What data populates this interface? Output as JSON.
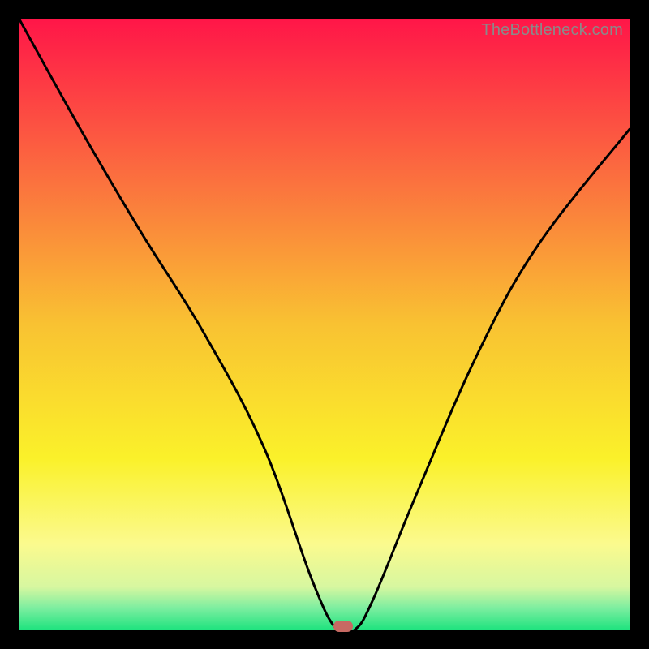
{
  "watermark": "TheBottleneck.com",
  "chart_data": {
    "type": "line",
    "title": "",
    "xlabel": "",
    "ylabel": "",
    "xlim": [
      0,
      100
    ],
    "ylim": [
      0,
      100
    ],
    "grid": false,
    "series": [
      {
        "name": "bottleneck-curve",
        "x": [
          0,
          10,
          20,
          30,
          40,
          48,
          52,
          55,
          58,
          65,
          75,
          85,
          100
        ],
        "y": [
          100,
          82,
          65,
          49,
          30,
          8,
          0,
          0,
          5,
          22,
          45,
          63,
          82
        ],
        "color": "#000000"
      }
    ],
    "marker": {
      "name": "optimal-point",
      "x": 53,
      "y": 0,
      "color": "#c76a63"
    },
    "background_gradient": {
      "stops": [
        {
          "pos": 0.0,
          "color": "#ff1648"
        },
        {
          "pos": 0.25,
          "color": "#fb6c3f"
        },
        {
          "pos": 0.5,
          "color": "#f9c232"
        },
        {
          "pos": 0.72,
          "color": "#faf12a"
        },
        {
          "pos": 0.86,
          "color": "#fbfa8e"
        },
        {
          "pos": 0.93,
          "color": "#d7f7a0"
        },
        {
          "pos": 0.965,
          "color": "#7ceea0"
        },
        {
          "pos": 1.0,
          "color": "#20e37f"
        }
      ]
    }
  }
}
